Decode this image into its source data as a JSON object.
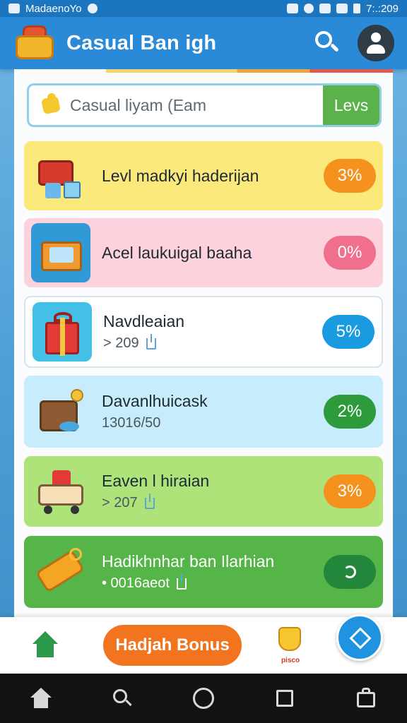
{
  "status_bar": {
    "left_text": "Madaeno​Yo",
    "right_text": "7:.:209"
  },
  "app_bar": {
    "title": "Casual Ban igh",
    "search_icon": "search-icon",
    "profile_icon": "profile-icon"
  },
  "search": {
    "placeholder": "Casual liyam (Eam",
    "button_label": "Levs"
  },
  "cards": [
    {
      "title": "Levl madkyi haderijan",
      "sub": "",
      "pct": "3%",
      "bg": "#fbe97c",
      "pct_color": "#f5921e"
    },
    {
      "title": "Acel laukuigal baaha",
      "sub": "",
      "pct": "0%",
      "bg": "#fcd3dc",
      "pct_color": "#ef6f8c"
    },
    {
      "title": "Navdleaian",
      "sub": "> 209",
      "pct": "5%",
      "bg": "#ffffff",
      "pct_color": "#1a9ae0"
    },
    {
      "title": "Davanlhuicask",
      "sub": "13016/50",
      "pct": "2%",
      "bg": "#c7ecfb",
      "pct_color": "#2d9a3b"
    },
    {
      "title": "Eaven l hiraian",
      "sub": "> 207",
      "pct": "3%",
      "bg": "#aee37a",
      "pct_color": "#f5921e"
    },
    {
      "title": "Hadikhnhar ban Ilarhian",
      "sub": "• 0016aeot",
      "pct": "",
      "bg": "#56b548",
      "pct_color": "#22873a"
    }
  ],
  "bottom_nav": {
    "bonus_label": "Hadjah Bonus",
    "reward_label": "pisco"
  }
}
